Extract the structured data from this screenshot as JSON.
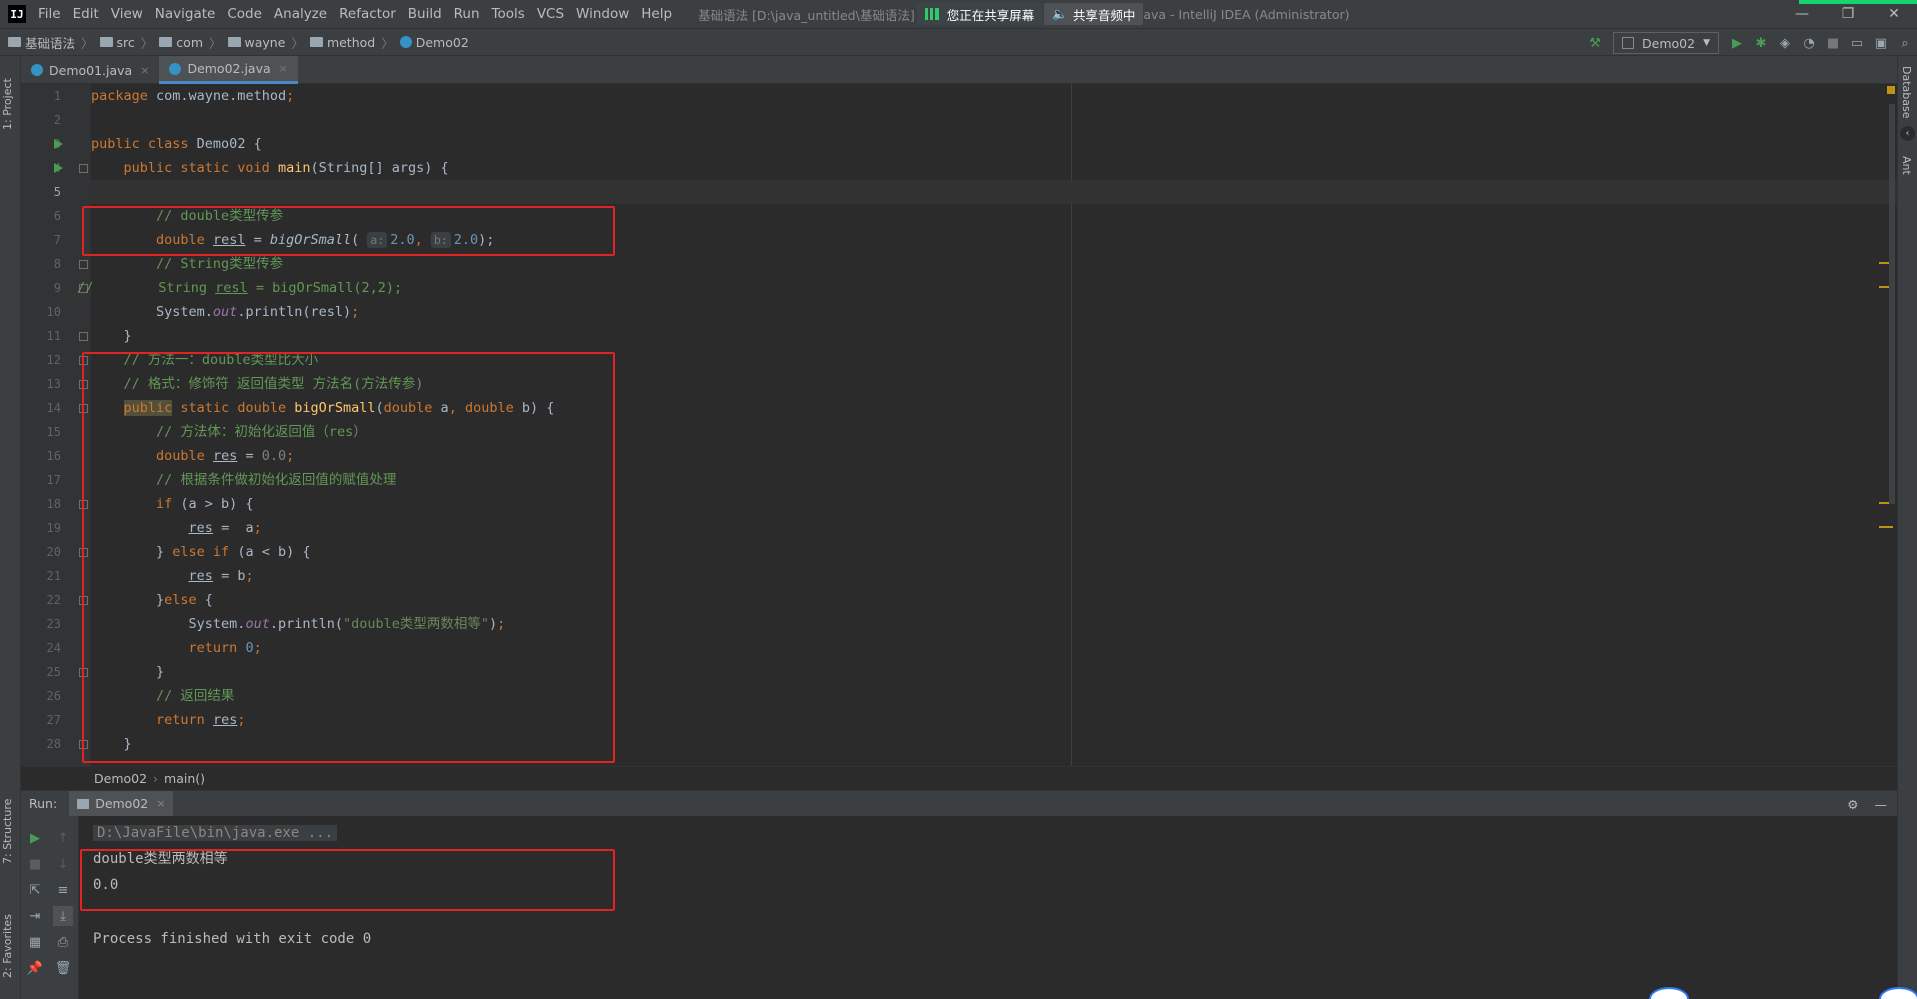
{
  "menubar": {
    "logo": "IJ",
    "items": [
      "File",
      "Edit",
      "View",
      "Navigate",
      "Code",
      "Analyze",
      "Refactor",
      "Build",
      "Run",
      "Tools",
      "VCS",
      "Window",
      "Help"
    ],
    "window_title_left": "基础语法 [D:\\java_untitled\\基础语法]",
    "share_screen": "您正在共享屏幕",
    "share_audio": "共享音频中",
    "window_title_right": "ava - IntelliJ IDEA (Administrator)",
    "minimize": "—",
    "restore": "❐",
    "close": "✕"
  },
  "navbar": {
    "crumbs": [
      "基础语法",
      "src",
      "com",
      "wayne",
      "method",
      "Demo02"
    ],
    "run_config": "Demo02"
  },
  "left_strip": {
    "project": "1: Project",
    "structure": "7: Structure",
    "favorites": "2: Favorites"
  },
  "right_strip": {
    "database": "Database",
    "ant": "Ant"
  },
  "tabs": [
    {
      "label": "Demo01.java",
      "close": "×"
    },
    {
      "label": "Demo02.java",
      "close": "×"
    }
  ],
  "editor": {
    "line_numbers": [
      "1",
      "2",
      "3",
      "4",
      "5",
      "6",
      "7",
      "8",
      "9",
      "10",
      "11",
      "12",
      "13",
      "14",
      "15",
      "16",
      "17",
      "18",
      "19",
      "20",
      "21",
      "22",
      "23",
      "24",
      "25",
      "26",
      "27",
      "28"
    ],
    "l1_pkg": "package",
    "l1_name": " com.wayne.method",
    "l1_semi": ";",
    "l3_kw": "public class",
    "l3_rest": " Demo02 {",
    "l4_kw": "    public static void",
    "l4_fn": " main",
    "l4_rest": "(String[] args) {",
    "l6_cm": "        // double类型传参",
    "l7_kw": "        double",
    "l7_var": "resl",
    "l7_eq": " = ",
    "l7_call": "bigOrSmall",
    "l7_open": "(",
    "l7_hint_a": "a:",
    "l7_val_a": "2.0",
    "l7_comma": ", ",
    "l7_hint_b": "b:",
    "l7_val_b": "2.0",
    "l7_close": ");",
    "l8_cm": "        // String类型传参",
    "l9_cm": "//        String ",
    "l9_var": "resl",
    "l9_rest": " = bigOrSmall(2,2);",
    "l10_a": "        System.",
    "l10_out": "out",
    "l10_b": ".println(resl)",
    "l10_semi": ";",
    "l11": "    }",
    "l12_cm": "    // 方法一：double类型比大小",
    "l13_cm": "    // 格式：修饰符 返回值类型 方法名(方法传参)",
    "l14_pub": "public",
    "l14_kw": " static double",
    "l14_fn": " bigOrSmall",
    "l14_open": "(",
    "l14_kw2": "double",
    "l14_a": " a",
    "l14_comma": ", ",
    "l14_kw3": "double",
    "l14_rest": " b) {",
    "l15_cm": "        // 方法体：初始化返回值（res）",
    "l16_kw": "        double",
    "l16_var": "res",
    "l16_eq": " = ",
    "l16_num": "0.0",
    "l16_semi": ";",
    "l17_cm": "        // 根据条件做初始化返回值的赋值处理",
    "l18_kw": "        if",
    "l18_rest": " (a > b) {",
    "l19_var": "res",
    "l19_rest": " =  a",
    "l19_semi": ";",
    "l20_a": "        } ",
    "l20_kw": "else if",
    "l20_rest": " (a < b) {",
    "l21_var": "res",
    "l21_rest": " = b",
    "l21_semi": ";",
    "l22_a": "        }",
    "l22_kw": "else",
    "l22_rest": " {",
    "l23_a": "            System.",
    "l23_out": "out",
    "l23_b": ".println(",
    "l23_str": "\"double类型两数相等\"",
    "l23_c": ")",
    "l23_semi": ";",
    "l24_kw": "            return",
    "l24_num": " 0",
    "l24_semi": ";",
    "l25": "        }",
    "l26_cm": "        // 返回结果",
    "l27_kw": "        return",
    "l27_var": "res",
    "l27_semi": ";",
    "l28": "    }"
  },
  "editor_breadcrumb": [
    "Demo02",
    "main()"
  ],
  "run": {
    "label": "Run:",
    "tab": "Demo02",
    "tab_close": "×",
    "settings_icon": "⚙",
    "hide_icon": "—",
    "console": {
      "cmd": "D:\\JavaFile\\bin\\java.exe ...",
      "out1": "double类型两数相等",
      "out2": "0.0",
      "finish": "Process finished with exit code 0"
    }
  },
  "colors": {
    "bg": "#2b2b2b",
    "panel": "#3c3f41",
    "keyword": "#cc7832",
    "comment": "#629755",
    "number": "#6897bb",
    "string": "#6a8759",
    "method": "#ffc66d",
    "static_field": "#9876aa",
    "annotation_box": "#e02424",
    "share_green": "#17d36b"
  }
}
